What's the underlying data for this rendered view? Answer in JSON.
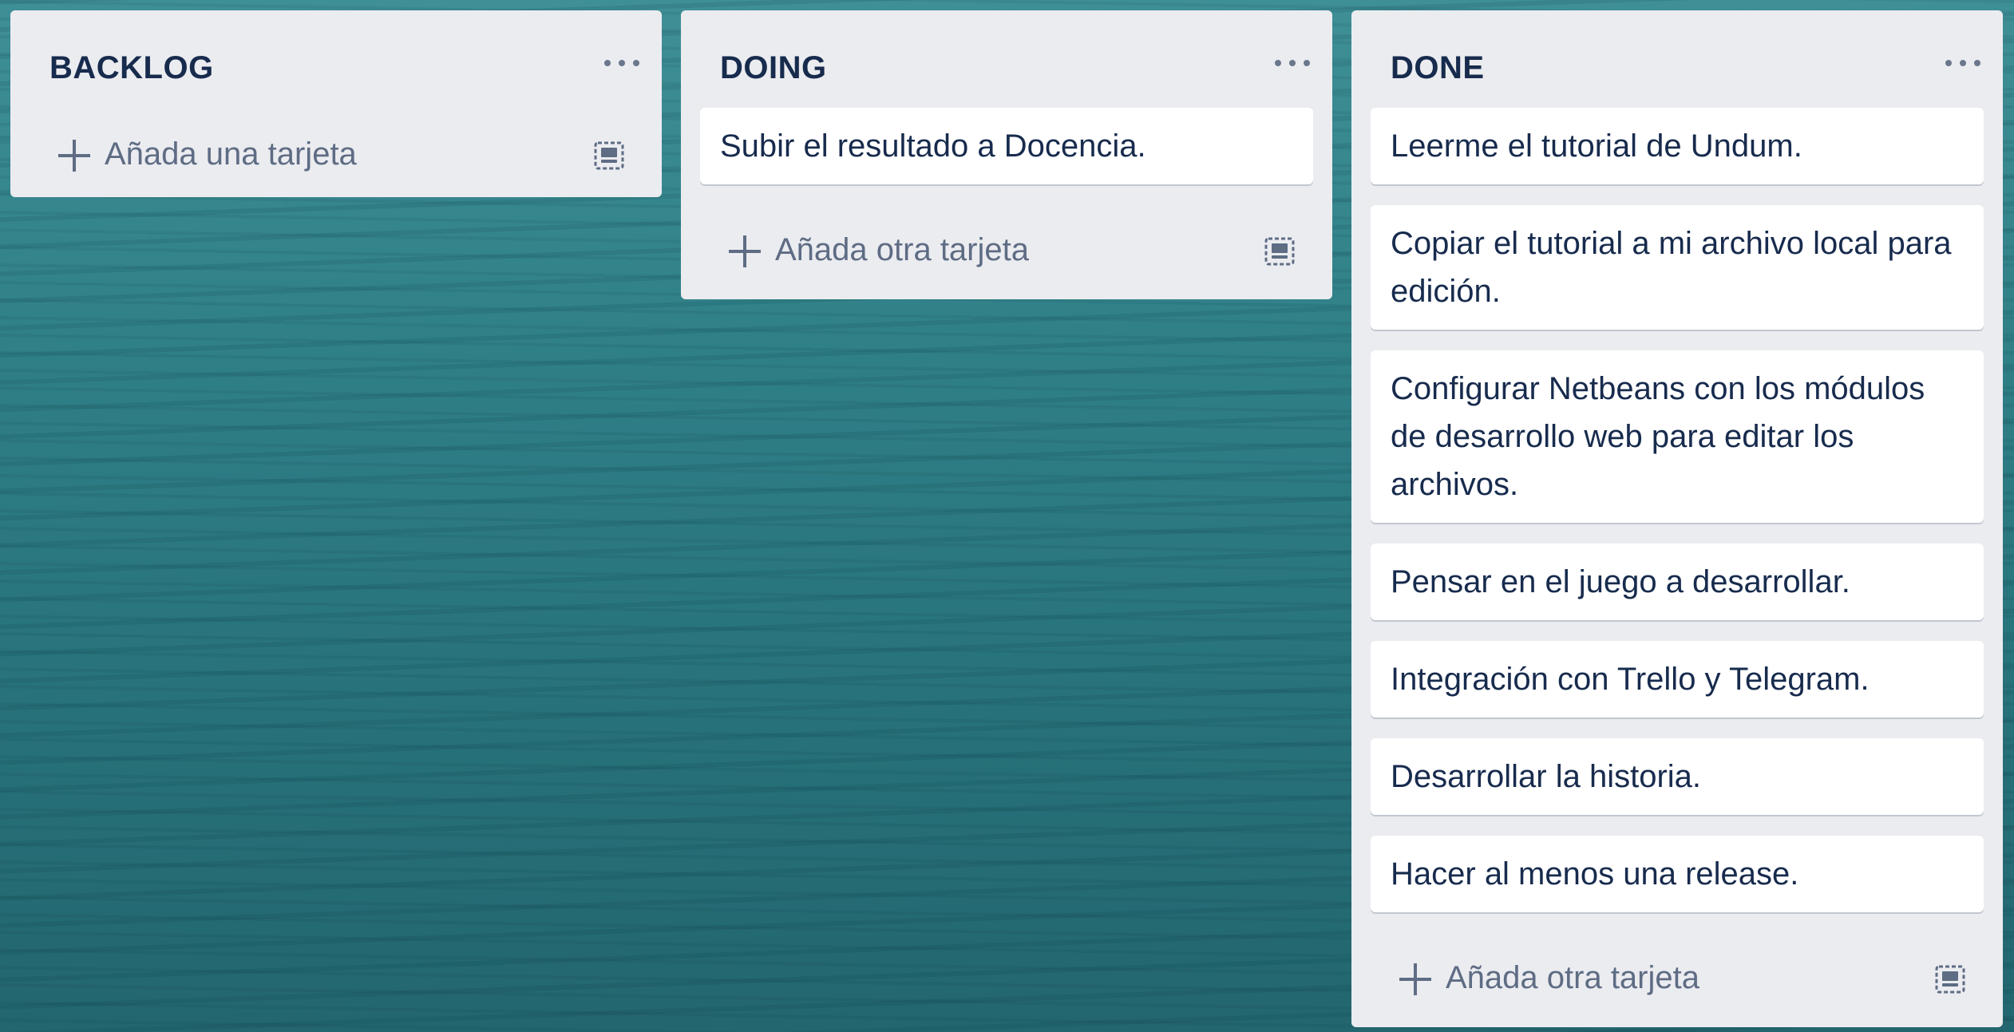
{
  "board": {
    "lists": [
      {
        "title": "BACKLOG",
        "cards": [],
        "add_label": "Añada una tarjeta"
      },
      {
        "title": "DOING",
        "cards": [
          "Subir el resultado a Docencia."
        ],
        "add_label": "Añada otra tarjeta"
      },
      {
        "title": "DONE",
        "cards": [
          "Leerme el tutorial de Undum.",
          "Copiar el tutorial a mi archivo local para edición.",
          "Configurar Netbeans con los módulos de desarrollo web para editar los archivos.",
          "Pensar en el juego a desarrollar.",
          "Integración con Trello y Telegram.",
          "Desarrollar la historia.",
          "Hacer al menos una release."
        ],
        "add_label": "Añada otra tarjeta"
      }
    ]
  },
  "icons": {
    "menu": "more-horizontal-icon",
    "add": "plus-icon",
    "template": "card-template-icon"
  },
  "colors": {
    "list_background": "#ebecf0",
    "card_background": "#ffffff",
    "title_text": "#172b4d",
    "muted_text": "#5e6c84",
    "board_background": "#2f7f87"
  }
}
